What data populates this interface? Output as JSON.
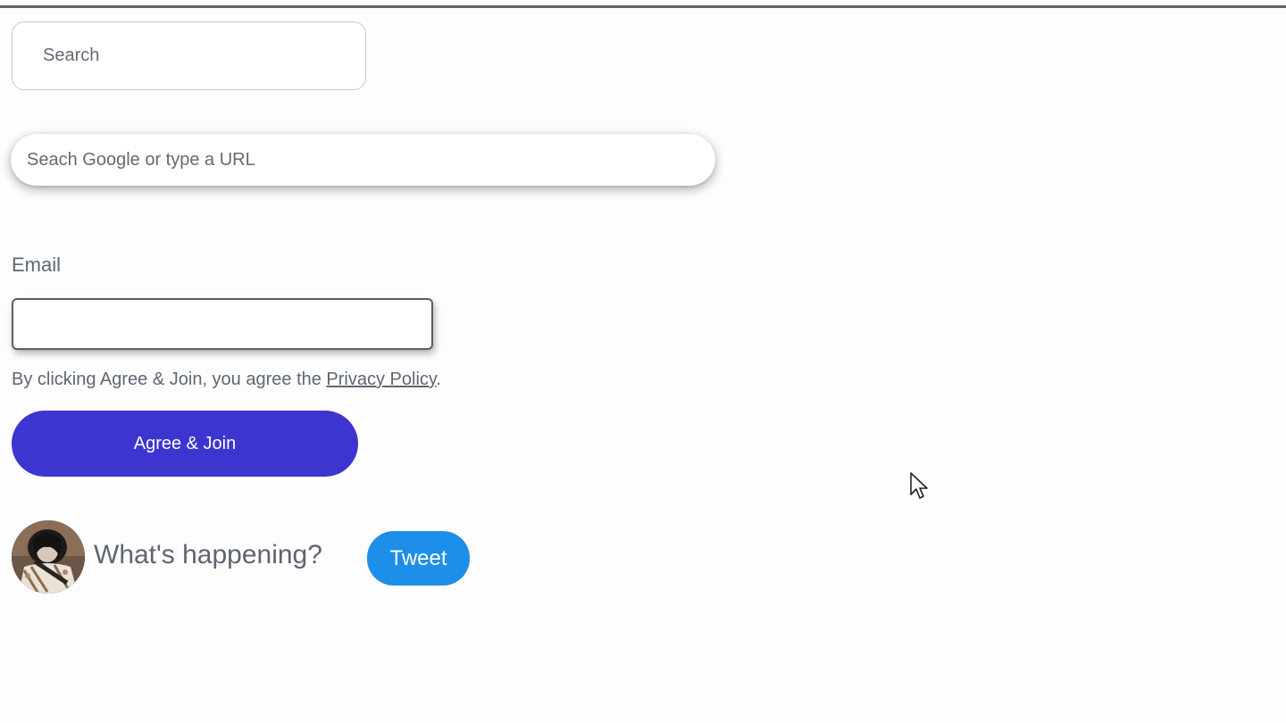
{
  "search": {
    "placeholder": "Search"
  },
  "google_search": {
    "placeholder": "Seach Google or type a URL"
  },
  "signup": {
    "email_label": "Email",
    "email_value": "",
    "agree_prefix": "By clicking Agree & Join, you agree the ",
    "privacy_link": "Privacy Policy",
    "agree_suffix": ".",
    "join_label": "Agree & Join",
    "join_color": "#3d35cf"
  },
  "composer": {
    "prompt": "What's happening?",
    "tweet_label": "Tweet",
    "tweet_color": "#1d8fe8",
    "avatar_icon": "avatar"
  },
  "cursor": {
    "icon": "mouse-pointer-icon"
  }
}
